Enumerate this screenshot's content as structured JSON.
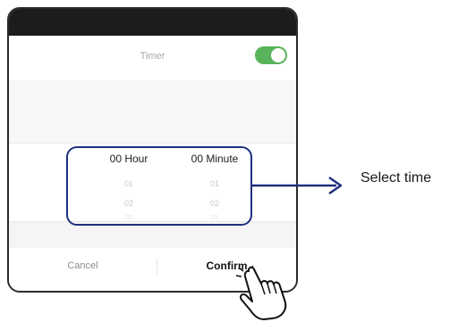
{
  "timer": {
    "label": "Timer",
    "enabled": true,
    "toggle_color": "#59b35a"
  },
  "picker": {
    "hour": {
      "header": "00 Hour",
      "items": [
        "01",
        "02",
        "03"
      ]
    },
    "minute": {
      "header": "00 Minute",
      "items": [
        "01",
        "02",
        "03"
      ]
    }
  },
  "actions": {
    "cancel_label": "Cancel",
    "confirm_label": "Confirm"
  },
  "annotation": {
    "callout_text": "Select time",
    "highlight_color": "#1f2f7e"
  }
}
